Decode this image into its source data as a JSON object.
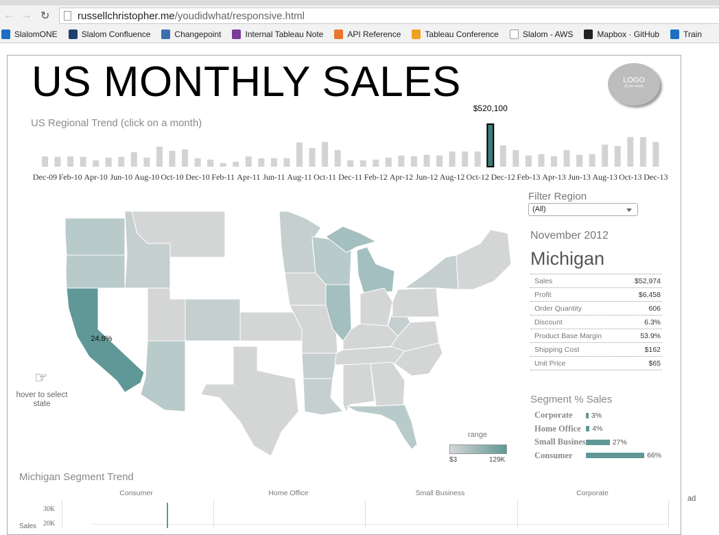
{
  "browser": {
    "url_domain": "russellchristopher.me",
    "url_path": "/youdidwhat/responsive.html",
    "bookmarks": [
      {
        "label": "SlalomONE",
        "icon": "sharepoint-icon",
        "color": "#1e6fc4"
      },
      {
        "label": "Slalom Confluence",
        "icon": "confluence-icon",
        "color": "#1f3f6e"
      },
      {
        "label": "Changepoint",
        "icon": "changepoint-icon",
        "color": "#3a6fb0"
      },
      {
        "label": "Internal Tableau Note",
        "icon": "onenote-icon",
        "color": "#7b3a96"
      },
      {
        "label": "API Reference",
        "icon": "tableau-icon",
        "color": "#e8762c"
      },
      {
        "label": "Tableau Conference",
        "icon": "chart-icon",
        "color": "#f0a020"
      },
      {
        "label": "Slalom - AWS",
        "icon": "document-icon",
        "color": "#ffffff"
      },
      {
        "label": "Mapbox · GitHub",
        "icon": "github-icon",
        "color": "#222222"
      },
      {
        "label": "Train",
        "icon": "sharepoint-icon",
        "color": "#1e6fc4"
      }
    ]
  },
  "dashboard": {
    "title": "US MONTHLY SALES",
    "logo_text": "LOGO",
    "logo_subtext": "(if you must)",
    "trend_title": "US Regional Trend (click on a month)",
    "selected_value_label": "$520,100",
    "filter": {
      "label": "Filter Region",
      "value": "(All)"
    },
    "detail": {
      "month": "November 2012",
      "state": "Michigan",
      "stats": [
        {
          "label": "Sales",
          "value": "$52,974"
        },
        {
          "label": "Profit",
          "value": "$6,458"
        },
        {
          "label": "Order Quantity",
          "value": "606"
        },
        {
          "label": "Discount",
          "value": "6.3%"
        },
        {
          "label": "Product Base Margin",
          "value": "53.9%"
        },
        {
          "label": "Shipping Cost",
          "value": "$162"
        },
        {
          "label": "Unit Price",
          "value": "$65"
        }
      ]
    },
    "segments": {
      "title": "Segment % Sales",
      "items": [
        {
          "label": "Corporate",
          "pct": 3,
          "text": "3%"
        },
        {
          "label": "Home Office",
          "pct": 4,
          "text": "4%"
        },
        {
          "label": "Small Business",
          "pct": 27,
          "text": "27%"
        },
        {
          "label": "Consumer",
          "pct": 66,
          "text": "66%"
        }
      ]
    },
    "map": {
      "state_label": "24.8%",
      "hover_hint": "hover to select state",
      "legend_title": "range",
      "legend_min": "$3",
      "legend_max": "129K",
      "color_low": "#d4d6d6",
      "color_high": "#5f9896"
    },
    "segment_trend": {
      "title": "Michigan Segment Trend",
      "columns": [
        "Consumer",
        "Home Office",
        "Small Business",
        "Corporate"
      ],
      "y_label": "Sales",
      "y_ticks": [
        "30K",
        "20K"
      ]
    },
    "side_fragment": "ad"
  },
  "chart_data": {
    "type": "bar",
    "title": "US Regional Trend (click on a month)",
    "tick_labels": [
      "Dec-09",
      "Feb-10",
      "Apr-10",
      "Jun-10",
      "Aug-10",
      "Oct-10",
      "Dec-10",
      "Feb-11",
      "Apr-11",
      "Jun-11",
      "Aug-11",
      "Oct-11",
      "Dec-11",
      "Feb-12",
      "Apr-12",
      "Jun-12",
      "Aug-12",
      "Oct-12",
      "Dec-12",
      "Feb-13",
      "Apr-13",
      "Jun-13",
      "Aug-13",
      "Oct-13",
      "Dec-13"
    ],
    "values": [
      125000,
      120000,
      125000,
      120000,
      78000,
      111000,
      120000,
      178000,
      111000,
      245000,
      195000,
      211000,
      103000,
      86000,
      44000,
      61000,
      125000,
      103000,
      103000,
      103000,
      295000,
      228000,
      303000,
      203000,
      78000,
      78000,
      86000,
      111000,
      136000,
      128000,
      145000,
      136000,
      186000,
      186000,
      186000,
      520100,
      261000,
      203000,
      136000,
      153000,
      128000,
      203000,
      145000,
      153000,
      270000,
      253000,
      362000,
      362000,
      303000
    ],
    "selected_index": 35,
    "bar_color": "#d3d3d3",
    "selected_color": "#3e7c79",
    "ylim": [
      0,
      520100
    ]
  }
}
